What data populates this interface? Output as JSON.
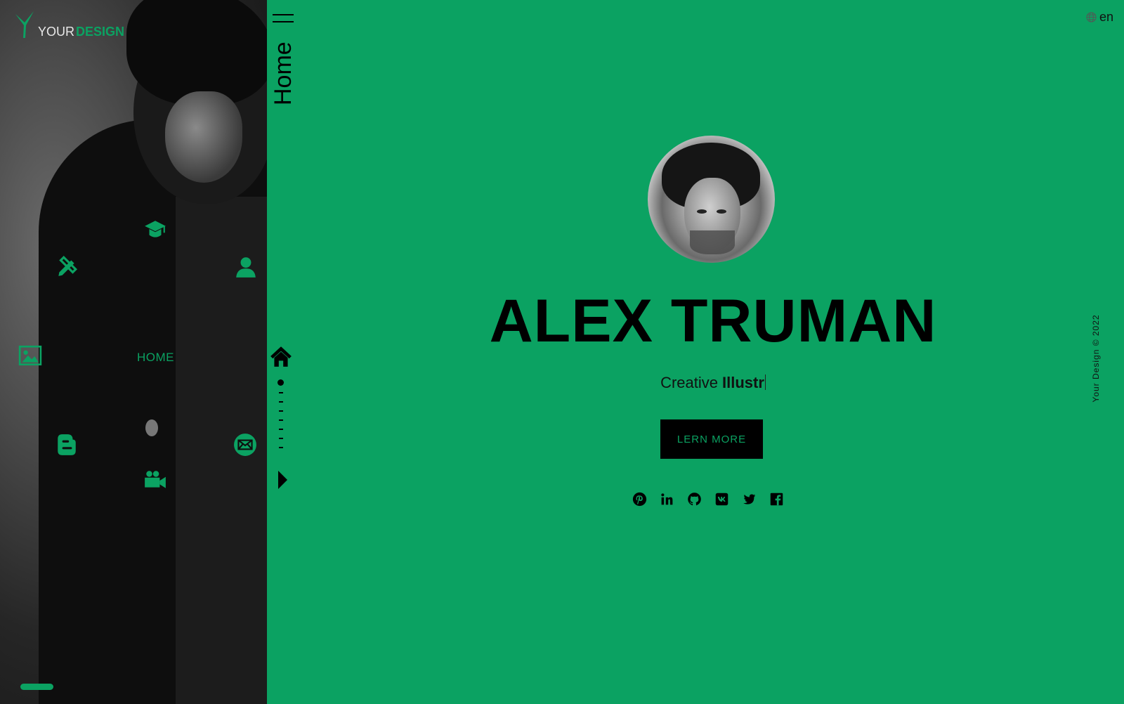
{
  "brand": {
    "word_light": "YOUR",
    "word_bold": "DESIGN",
    "accent_color": "#0ba262",
    "background_color": "#0ba262"
  },
  "left_nav": {
    "items": [
      {
        "name": "education",
        "icon": "graduation-cap-icon"
      },
      {
        "name": "skills",
        "icon": "pencil-ruler-icon"
      },
      {
        "name": "about",
        "icon": "user-icon"
      },
      {
        "name": "portfolio",
        "icon": "image-icon"
      },
      {
        "name": "home",
        "label": "HOME"
      },
      {
        "name": "blog",
        "icon": "blogger-icon"
      },
      {
        "name": "contact",
        "icon": "envelope-icon"
      },
      {
        "name": "video",
        "icon": "video-camera-icon"
      }
    ]
  },
  "strip": {
    "title": "Home",
    "menu_icon": "hamburger-icon",
    "home_icon": "home-icon",
    "next_icon": "play-arrow-icon"
  },
  "lang": {
    "label": "en",
    "icon": "globe-icon"
  },
  "hero": {
    "name": "ALEX TRUMAN",
    "tagline_prefix": "Creative",
    "tagline_typed": "Illustr",
    "cta_label": "LERN MORE"
  },
  "socials": [
    "pinterest-icon",
    "linkedin-icon",
    "github-icon",
    "vk-icon",
    "twitter-icon",
    "facebook-icon"
  ],
  "copyright": "Your Design © 2022"
}
